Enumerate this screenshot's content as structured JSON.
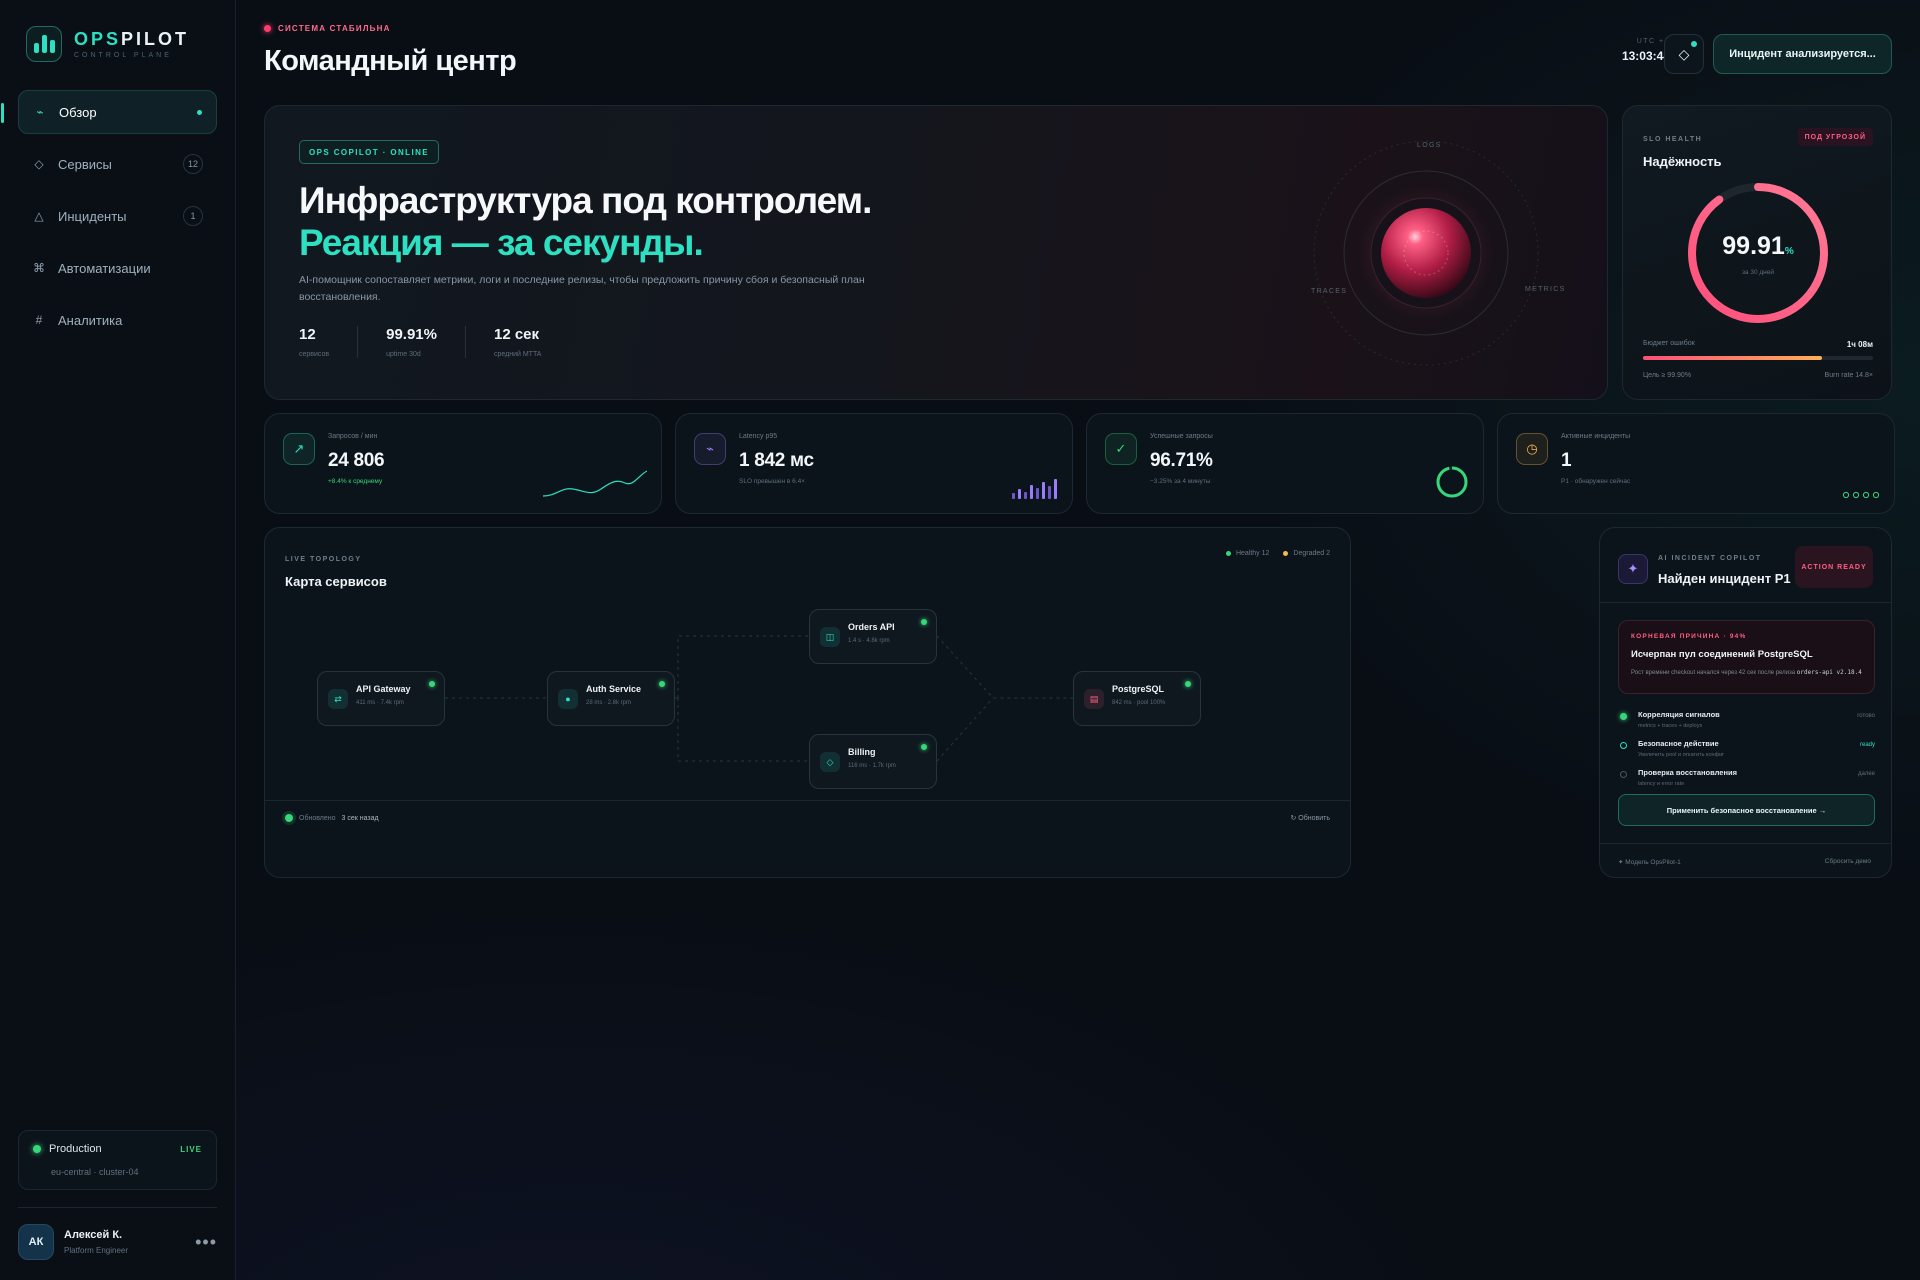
{
  "brand": {
    "logo_bold": "OPS",
    "logo_rest": "PILOT",
    "logo_sub": "CONTROL PLANE"
  },
  "nav": [
    {
      "label": "Обзор",
      "icon": "activity-icon",
      "glyph": "⌁",
      "active": true,
      "badge": ""
    },
    {
      "label": "Сервисы",
      "icon": "diamond-icon",
      "glyph": "◇",
      "active": false,
      "badge": "12"
    },
    {
      "label": "Инциденты",
      "icon": "triangle-icon",
      "glyph": "△",
      "active": false,
      "badge": "1"
    },
    {
      "label": "Автоматизации",
      "icon": "command-icon",
      "glyph": "⌘",
      "active": false,
      "badge": ""
    },
    {
      "label": "Аналитика",
      "icon": "hash-icon",
      "glyph": "#",
      "active": false,
      "badge": ""
    }
  ],
  "environment": {
    "name": "Production",
    "live": "LIVE",
    "cluster": "eu-central · cluster-04"
  },
  "user": {
    "initials": "АК",
    "name": "Алексей К.",
    "role": "Platform Engineer",
    "more": "•••"
  },
  "header": {
    "status": "СИСТЕМА СТАБИЛЬНА",
    "title": "Командный центр",
    "tz": "UTC +3",
    "time": "13:03:44",
    "incident_button": "Инцидент анализируется..."
  },
  "hero": {
    "tag": "OPS COPILOT · ONLINE",
    "title": "Инфраструктура под контролем.",
    "accent": "Реакция — за секунды.",
    "description": "AI-помощник сопоставляет метрики, логи и последние релизы, чтобы предложить причину сбоя и безопасный план восстановления.",
    "stats": [
      {
        "value": "12",
        "label": "сервисов"
      },
      {
        "value": "99.91%",
        "label": "uptime 30d"
      },
      {
        "value": "12 сек",
        "label": "средний MTTA"
      }
    ],
    "orbit_labels": {
      "logs": "LOGS",
      "traces": "TRACES",
      "metrics": "METRICS"
    }
  },
  "slo": {
    "caption": "SLO HEALTH",
    "title": "Надёжность",
    "badge": "ПОД УГРОЗОЙ",
    "value": "99.91",
    "unit": "%",
    "period": "за 30 дней",
    "gauge_fraction": 0.9,
    "budget_label": "Бюджет ошибок",
    "budget_value": "1ч 08м",
    "budget_fraction": 0.78,
    "target": "Цель ≥ 99.90%",
    "burn_rate": "Burn rate 14.8×"
  },
  "kpis": [
    {
      "label": "Запросов / мин",
      "value": "24 806",
      "sub": "+8.4% к среднему",
      "icon": "trend-up-icon",
      "glyph": "↗",
      "color": "#2de0c2",
      "sub_color": "#37d67a"
    },
    {
      "label": "Latency p95",
      "value": "1 842 мс",
      "sub": "SLO превышен в 6.4×",
      "icon": "pulse-icon",
      "glyph": "⌁",
      "color": "#9b7cff",
      "sub_color": "#5e6e7b"
    },
    {
      "label": "Успешные запросы",
      "value": "96.71%",
      "sub": "−3.25% за 4 минуты",
      "icon": "check-icon",
      "glyph": "✓",
      "color": "#37d67a",
      "sub_color": "#5e6e7b",
      "ring_fraction": 0.9671
    },
    {
      "label": "Активные инциденты",
      "value": "1",
      "sub": "P1 · обнаружен сейчас",
      "icon": "clock-icon",
      "glyph": "◷",
      "color": "#f5b84a",
      "sub_color": "#5e6e7b"
    }
  ],
  "topology": {
    "caption": "LIVE TOPOLOGY",
    "title": "Карта сервисов",
    "legend_healthy": "Healthy 12",
    "legend_degraded": "Degraded 2",
    "nodes": [
      {
        "name": "API Gateway",
        "sub": "411 ms · 7.4k rpm",
        "icon": "swap-icon",
        "glyph": "⇄",
        "color": "#2de0c2"
      },
      {
        "name": "Auth Service",
        "sub": "28 ms · 2.8k rpm",
        "icon": "shield-icon",
        "glyph": "●",
        "color": "#2de0c2"
      },
      {
        "name": "Orders API",
        "sub": "1.4 s · 4.8k rpm",
        "icon": "box-icon",
        "glyph": "◫",
        "color": "#2de0c2"
      },
      {
        "name": "Billing",
        "sub": "116 ms · 1.7k rpm",
        "icon": "diamond-icon",
        "glyph": "◇",
        "color": "#2de0c2"
      },
      {
        "name": "PostgreSQL",
        "sub": "842 ms · pool 100%",
        "icon": "database-icon",
        "glyph": "▤",
        "color": "#ff5f85"
      }
    ],
    "updated_label": "Обновлено",
    "updated_value": "3 сек назад",
    "refresh": "↻ Обновить"
  },
  "copilot": {
    "caption": "AI INCIDENT COPILOT",
    "title": "Найден инцидент P1",
    "badge": "ACTION READY",
    "cause_caption": "КОРНЕВАЯ ПРИЧИНА · 94%",
    "cause_title": "Исчерпан пул соединений PostgreSQL",
    "cause_desc": "Рост времени checkout начался через 42 сек после релиза",
    "cause_release": "orders-api v2.18.4",
    "steps": [
      {
        "title": "Корреляция сигналов",
        "sub": "metrics + traces + deploys",
        "status": "готово",
        "state": "done"
      },
      {
        "title": "Безопасное действие",
        "sub": "Увеличить pool и откатить конфиг",
        "status": "ready",
        "state": "ready"
      },
      {
        "title": "Проверка восстановления",
        "sub": "latency и error rate",
        "status": "далее",
        "state": "next"
      }
    ],
    "apply_button": "Применить безопасное восстановление →",
    "model": "✦ Модель OpsPilot-1",
    "reset": "Сбросить демо"
  },
  "colors": {
    "accent": "#2de0c2",
    "danger": "#ff5f85",
    "success": "#37d67a",
    "warning": "#f5b84a",
    "violet": "#9b7cff"
  }
}
